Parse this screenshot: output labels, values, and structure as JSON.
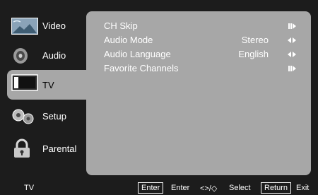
{
  "sidebar": {
    "items": [
      {
        "label": "Video",
        "icon": "video-landscape-icon"
      },
      {
        "label": "Audio",
        "icon": "speaker-icon"
      },
      {
        "label": "TV",
        "icon": "tv-screen-icon",
        "selected": true
      },
      {
        "label": "Setup",
        "icon": "gears-icon"
      },
      {
        "label": "Parental",
        "icon": "padlock-icon"
      }
    ]
  },
  "menu": {
    "rows": [
      {
        "label": "CH Skip",
        "value": "",
        "control": "enter"
      },
      {
        "label": "Audio Mode",
        "value": "Stereo",
        "control": "left-right"
      },
      {
        "label": "Audio Language",
        "value": "English",
        "control": "left-right"
      },
      {
        "label": "Favorite Channels",
        "value": "",
        "control": "enter"
      }
    ]
  },
  "footer": {
    "section": "TV",
    "enter_key": "Enter",
    "enter_action": "Enter",
    "nav_symbol": "<>/◇",
    "nav_action": "Select",
    "return_key": "Return",
    "return_action": "Exit"
  },
  "colors": {
    "background": "#1c1c1c",
    "panel": "#a7a7a7",
    "text": "#ffffff"
  }
}
